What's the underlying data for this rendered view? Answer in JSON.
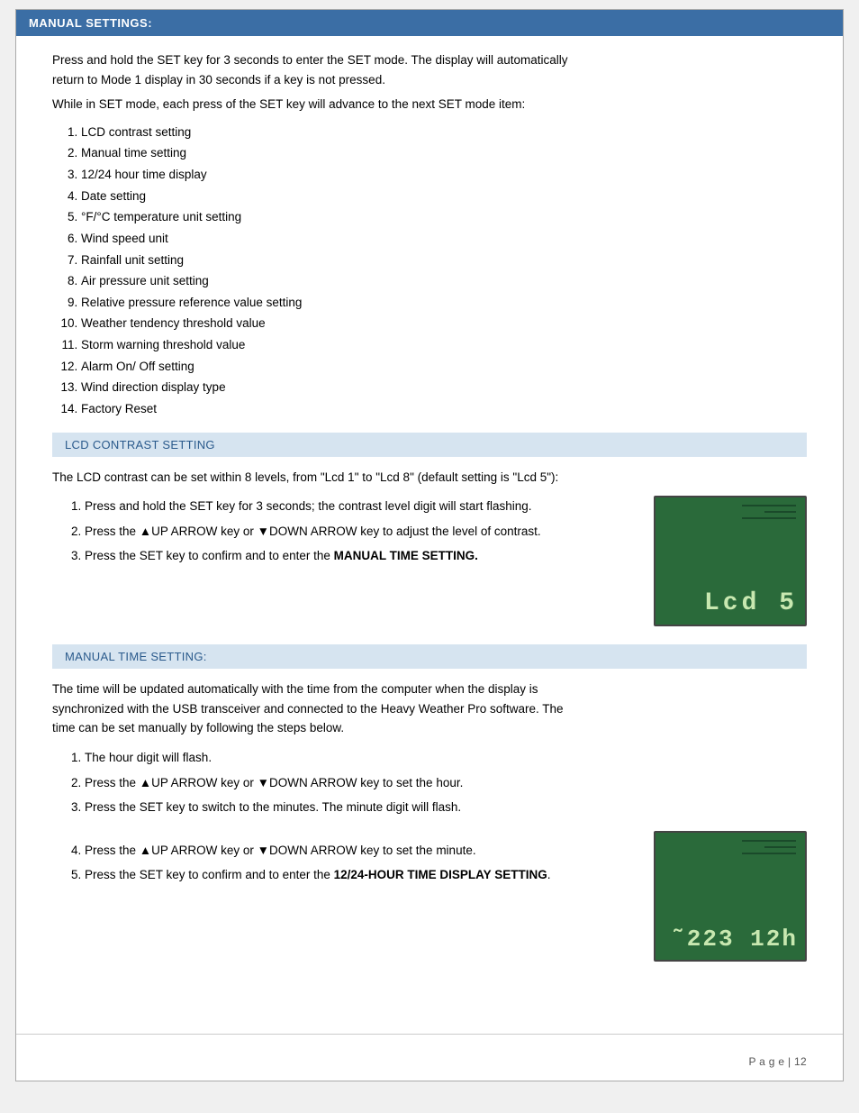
{
  "header": {
    "title": "MANUAL SETTINGS:"
  },
  "intro": {
    "line1": "Press and hold the SET key for 3 seconds to enter the SET mode. The display will automatically",
    "line2": "return to Mode 1 display in 30 seconds if a key is not pressed.",
    "line3": "While in SET mode, each press of the SET key will advance to the next SET mode item:"
  },
  "set_mode_items": [
    "LCD contrast setting",
    "Manual time setting",
    "12/24 hour time display",
    "Date setting",
    "°F/°C temperature unit setting",
    "Wind speed unit",
    "Rainfall unit setting",
    "Air pressure unit setting",
    "Relative pressure reference value setting",
    "Weather tendency threshold value",
    "Storm warning threshold value",
    "Alarm On/ Off setting",
    "Wind direction display type",
    "Factory Reset"
  ],
  "lcd_section": {
    "header": "LCD CONTRAST SETTING",
    "intro": "The LCD contrast can be set within 8 levels, from \"Lcd 1\" to \"Lcd 8\" (default setting is \"Lcd 5\"):",
    "steps": [
      "Press and hold the SET key for 3 seconds; the contrast level digit will start flashing.",
      "Press the ▲UP ARROW key or ▼DOWN ARROW key to adjust the level of contrast.",
      "Press the SET key to confirm and to enter the MANUAL TIME SETTING."
    ],
    "step3_bold_part": "MANUAL TIME SETTING.",
    "step3_prefix": "Press the SET key to confirm and to enter the ",
    "lcd_display": "Lcd  5"
  },
  "manual_time_section": {
    "header": "MANUAL TIME SETTING:",
    "intro1": "The time will be updated automatically with the time from the computer when the display is",
    "intro2": "synchronized with the USB transceiver and connected to the Heavy Weather Pro software. The",
    "intro3": "time can be set manually by following the steps below.",
    "steps": [
      "The hour digit will flash.",
      "Press the ▲UP ARROW key or ▼DOWN ARROW key to set the hour.",
      "Press the SET key to switch to the minutes. The minute digit will flash.",
      "Press the ▲UP ARROW key or ▼DOWN ARROW key to set the minute.",
      "Press the SET key to confirm and to enter the 12/24-HOUR TIME DISPLAY SETTING."
    ],
    "step5_prefix": "Press the SET key to confirm and to enter the ",
    "step5_bold": "12/24-HOUR TIME DISPLAY SETTING",
    "lcd_display": "˜223  12h"
  },
  "footer": {
    "text": "P a g e  |  12"
  }
}
